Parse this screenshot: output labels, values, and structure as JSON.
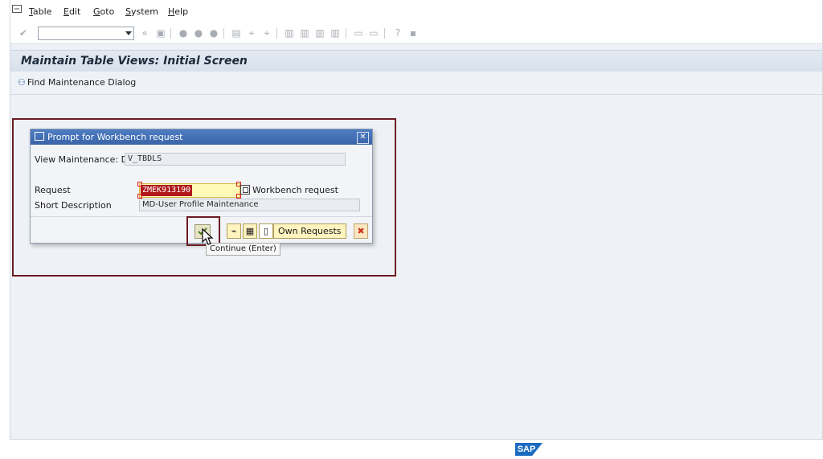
{
  "menu": {
    "items": [
      {
        "underline": "T",
        "rest": "able"
      },
      {
        "underline": "E",
        "rest": "dit"
      },
      {
        "underline": "G",
        "rest": "oto"
      },
      {
        "underline": "S",
        "rest": "ystem"
      },
      {
        "underline": "H",
        "rest": "elp"
      }
    ]
  },
  "page": {
    "title": "Maintain Table Views: Initial Screen",
    "find_button_label": "Find Maintenance Dialog"
  },
  "dialog": {
    "title": "Prompt for Workbench request",
    "view_label": "View Maintenance: D...",
    "view_value": "V_TBDLS",
    "request_label": "Request",
    "request_value": "ZMEK913190",
    "request_type_label": "Workbench request",
    "short_desc_label": "Short Description",
    "short_desc_value": "MD-User Profile Maintenance",
    "own_requests_label": "Own Requests",
    "cancel_symbol": "✖"
  },
  "tooltip": {
    "text": "Continue   (Enter)"
  },
  "footer": {
    "logo_text": "SAP"
  },
  "colors": {
    "dialog_title_bar": "#3a64a8",
    "highlight_border": "#6a1b22",
    "request_selection": "#b0181a",
    "request_field_bg": "#fff9b8"
  }
}
